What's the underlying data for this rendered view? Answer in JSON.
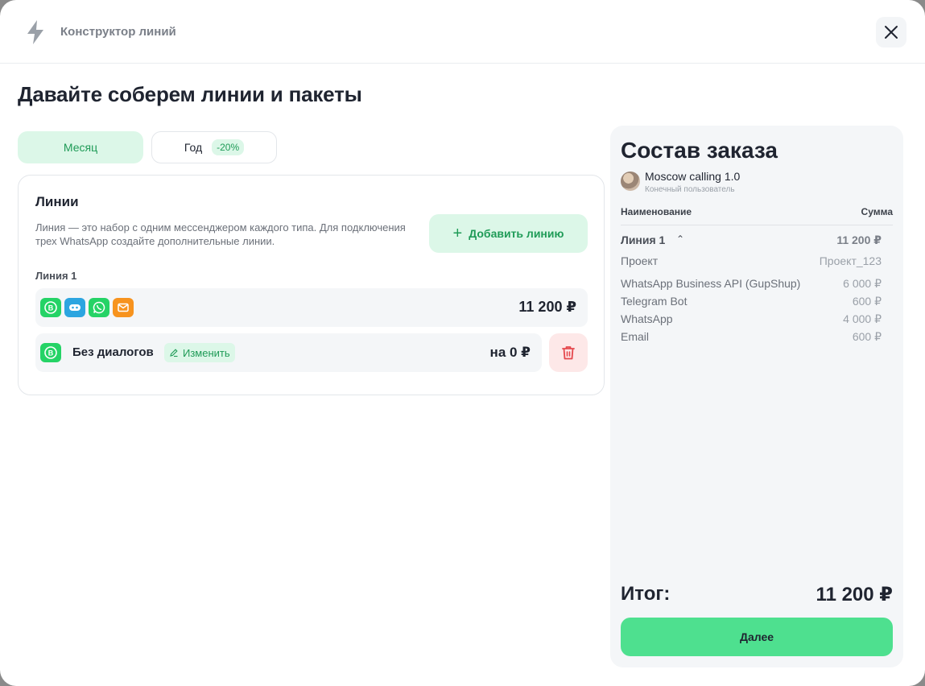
{
  "header": {
    "title": "Конструктор линий",
    "icon": "lightning-icon",
    "close_icon": "close-icon"
  },
  "page_title": "Давайте соберем линии и пакеты",
  "period_tabs": [
    {
      "label": "Месяц",
      "selected": true
    },
    {
      "label": "Год",
      "selected": false,
      "badge": "-20%"
    }
  ],
  "lines": {
    "heading": "Линии",
    "description": "Линия — это набор с одним мессенджером каждого типа. Для подключения трех WhatsApp создайте дополнительные линии.",
    "add_button": "Добавить линию",
    "items": [
      {
        "label": "Линия 1",
        "messengers": [
          {
            "icon": "whatsapp-business-icon",
            "color": "#25d366"
          },
          {
            "icon": "telegram-bot-icon",
            "color": "#2ca5e0"
          },
          {
            "icon": "whatsapp-icon",
            "color": "#25d366"
          },
          {
            "icon": "email-icon",
            "color": "#f7931e"
          }
        ],
        "price": "11 200 ₽",
        "package": {
          "name": "Без диалогов",
          "edit_label": "Изменить",
          "price": "на 0 ₽"
        }
      }
    ]
  },
  "summary": {
    "title": "Состав заказа",
    "client_name": "Moscow calling 1.0",
    "client_role": "Конечный пользователь",
    "col_name": "Наименование",
    "col_sum": "Сумма",
    "line_name": "Линия 1",
    "line_total": "11 200 ₽",
    "project_label": "Проект",
    "project_value": "Проект_123",
    "rows": [
      {
        "name": "WhatsApp Business API (GupShup)",
        "sum": "6 000 ₽"
      },
      {
        "name": "Telegram Bot",
        "sum": "600 ₽"
      },
      {
        "name": "WhatsApp",
        "sum": "4 000 ₽"
      },
      {
        "name": "Email",
        "sum": "600 ₽"
      }
    ],
    "total_label": "Итог:",
    "total_value": "11 200 ₽",
    "next_button": "Далее"
  },
  "colors": {
    "accent": "#4ee08f",
    "accent_soft": "#dcf7e8",
    "accent_text": "#1f9b57",
    "danger_soft": "#fde8e8",
    "danger": "#e5484d"
  }
}
